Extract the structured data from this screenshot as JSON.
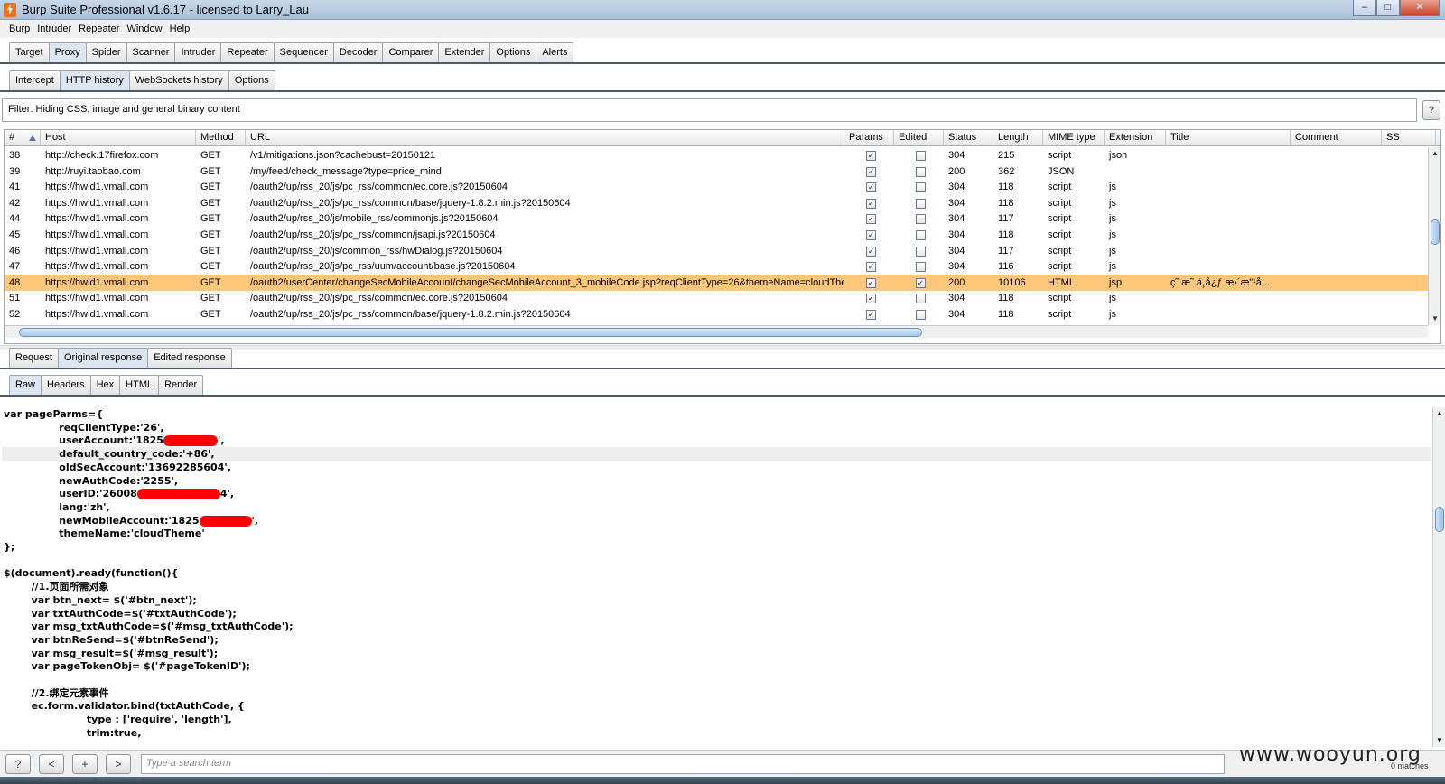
{
  "window": {
    "title": "Burp Suite Professional v1.6.17 - licensed to Larry_Lau"
  },
  "menu": [
    "Burp",
    "Intruder",
    "Repeater",
    "Window",
    "Help"
  ],
  "main_tabs": [
    "Target",
    "Proxy",
    "Spider",
    "Scanner",
    "Intruder",
    "Repeater",
    "Sequencer",
    "Decoder",
    "Comparer",
    "Extender",
    "Options",
    "Alerts"
  ],
  "proxy_tabs": [
    "Intercept",
    "HTTP history",
    "WebSockets history",
    "Options"
  ],
  "filter": {
    "text": "Filter:  Hiding CSS, image and general binary content"
  },
  "help_label": "?",
  "columns": [
    "#",
    "Host",
    "Method",
    "URL",
    "Params",
    "Edited",
    "Status",
    "Length",
    "MIME type",
    "Extension",
    "Title",
    "Comment",
    "SS"
  ],
  "rows": [
    {
      "num": "38",
      "host": "http://check.17firefox.com",
      "method": "GET",
      "url": "/v1/mitigations.json?cachebust=20150121",
      "params": true,
      "edited": false,
      "status": "304",
      "length": "215",
      "mime": "script",
      "ext": "json",
      "title": ""
    },
    {
      "num": "39",
      "host": "http://ruyi.taobao.com",
      "method": "GET",
      "url": "/my/feed/check_message?type=price_mind",
      "params": true,
      "edited": false,
      "status": "200",
      "length": "362",
      "mime": "JSON",
      "ext": "",
      "title": ""
    },
    {
      "num": "41",
      "host": "https://hwid1.vmall.com",
      "method": "GET",
      "url": "/oauth2/up/rss_20/js/pc_rss/common/ec.core.js?20150604",
      "params": true,
      "edited": false,
      "status": "304",
      "length": "118",
      "mime": "script",
      "ext": "js",
      "title": ""
    },
    {
      "num": "42",
      "host": "https://hwid1.vmall.com",
      "method": "GET",
      "url": "/oauth2/up/rss_20/js/pc_rss/common/base/jquery-1.8.2.min.js?20150604",
      "params": true,
      "edited": false,
      "status": "304",
      "length": "118",
      "mime": "script",
      "ext": "js",
      "title": ""
    },
    {
      "num": "44",
      "host": "https://hwid1.vmall.com",
      "method": "GET",
      "url": "/oauth2/up/rss_20/js/mobile_rss/commonjs.js?20150604",
      "params": true,
      "edited": false,
      "status": "304",
      "length": "117",
      "mime": "script",
      "ext": "js",
      "title": ""
    },
    {
      "num": "45",
      "host": "https://hwid1.vmall.com",
      "method": "GET",
      "url": "/oauth2/up/rss_20/js/pc_rss/common/jsapi.js?20150604",
      "params": true,
      "edited": false,
      "status": "304",
      "length": "118",
      "mime": "script",
      "ext": "js",
      "title": ""
    },
    {
      "num": "46",
      "host": "https://hwid1.vmall.com",
      "method": "GET",
      "url": "/oauth2/up/rss_20/js/common_rss/hwDialog.js?20150604",
      "params": true,
      "edited": false,
      "status": "304",
      "length": "117",
      "mime": "script",
      "ext": "js",
      "title": ""
    },
    {
      "num": "47",
      "host": "https://hwid1.vmall.com",
      "method": "GET",
      "url": "/oauth2/up/rss_20/js/pc_rss/uum/account/base.js?20150604",
      "params": true,
      "edited": false,
      "status": "304",
      "length": "116",
      "mime": "script",
      "ext": "js",
      "title": ""
    },
    {
      "num": "48",
      "host": "https://hwid1.vmall.com",
      "method": "GET",
      "url": "/oauth2/userCenter/changeSecMobileAccount/changeSecMobileAccount_3_mobileCode.jsp?reqClientType=26&themeName=cloudTheme",
      "params": true,
      "edited": true,
      "status": "200",
      "length": "10106",
      "mime": "HTML",
      "ext": "jsp",
      "title": "ç˜ æ˜ ä¸å¿ƒ æ›´æ”¹å...",
      "selected": true
    },
    {
      "num": "51",
      "host": "https://hwid1.vmall.com",
      "method": "GET",
      "url": "/oauth2/up/rss_20/js/pc_rss/common/ec.core.js?20150604",
      "params": true,
      "edited": false,
      "status": "304",
      "length": "118",
      "mime": "script",
      "ext": "js",
      "title": ""
    },
    {
      "num": "52",
      "host": "https://hwid1.vmall.com",
      "method": "GET",
      "url": "/oauth2/up/rss_20/js/pc_rss/common/base/jquery-1.8.2.min.js?20150604",
      "params": true,
      "edited": false,
      "status": "304",
      "length": "118",
      "mime": "script",
      "ext": "js",
      "title": ""
    }
  ],
  "response_tabs": [
    "Request",
    "Original response",
    "Edited response"
  ],
  "view_tabs": [
    "Raw",
    "Headers",
    "Hex",
    "HTML",
    "Render"
  ],
  "code": [
    {
      "text": "var pageParms={"
    },
    {
      "text": "                reqClientType:'26',"
    },
    {
      "text": "                userAccount:'1825",
      "redact": 60,
      "after": "',"
    },
    {
      "text": "                default_country_code:'+86',",
      "hl": true
    },
    {
      "text": "                oldSecAccount:'13692285604',"
    },
    {
      "text": "                newAuthCode:'2255',"
    },
    {
      "text": "                userID:'26008",
      "redact": 92,
      "after": "4',"
    },
    {
      "text": "                lang:'zh',"
    },
    {
      "text": "                newMobileAccount:'1825",
      "redact": 58,
      "after": "',"
    },
    {
      "text": "                themeName:'cloudTheme'"
    },
    {
      "text": "};"
    },
    {
      "text": ""
    },
    {
      "text": "$(document).ready(function(){"
    },
    {
      "text": "        //1.页面所需对象"
    },
    {
      "text": "        var btn_next= $('#btn_next');"
    },
    {
      "text": "        var txtAuthCode=$('#txtAuthCode');"
    },
    {
      "text": "        var msg_txtAuthCode=$('#msg_txtAuthCode');"
    },
    {
      "text": "        var btnReSend=$('#btnReSend');"
    },
    {
      "text": "        var msg_result=$('#msg_result');"
    },
    {
      "text": "        var pageTokenObj= $('#pageTokenID');"
    },
    {
      "text": ""
    },
    {
      "text": "        //2.绑定元素事件"
    },
    {
      "text": "        ec.form.validator.bind(txtAuthCode, {"
    },
    {
      "text": "                        type : ['require', 'length'],"
    },
    {
      "text": "                        trim:true,"
    }
  ],
  "search": {
    "placeholder": "Type a search term",
    "matches": "0 matches"
  },
  "nav_buttons": [
    "?",
    "<",
    "+",
    ">"
  ],
  "watermark": "www.wooyun.org",
  "colors": {
    "selected_row": "#ffc77a",
    "redaction": "#ff0000"
  }
}
